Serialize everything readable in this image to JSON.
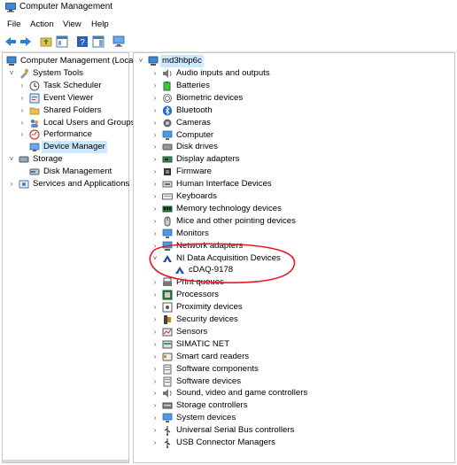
{
  "window": {
    "title": "Computer Management"
  },
  "menu": [
    "File",
    "Action",
    "View",
    "Help"
  ],
  "left_tree": [
    {
      "label": "Computer Management (Local)",
      "icon": "computer-management-icon",
      "level": 0,
      "expander": "",
      "selected": false
    },
    {
      "label": "System Tools",
      "icon": "tools-icon",
      "level": 1,
      "expander": "˅",
      "selected": false
    },
    {
      "label": "Task Scheduler",
      "icon": "clock-icon",
      "level": 2,
      "expander": "›",
      "selected": false
    },
    {
      "label": "Event Viewer",
      "icon": "event-viewer-icon",
      "level": 2,
      "expander": "›",
      "selected": false
    },
    {
      "label": "Shared Folders",
      "icon": "folder-icon",
      "level": 2,
      "expander": "›",
      "selected": false
    },
    {
      "label": "Local Users and Groups",
      "icon": "users-icon",
      "level": 2,
      "expander": "›",
      "selected": false
    },
    {
      "label": "Performance",
      "icon": "performance-icon",
      "level": 2,
      "expander": "›",
      "selected": false
    },
    {
      "label": "Device Manager",
      "icon": "device-manager-icon",
      "level": 2,
      "expander": "",
      "selected": true
    },
    {
      "label": "Storage",
      "icon": "storage-icon",
      "level": 1,
      "expander": "˅",
      "selected": false
    },
    {
      "label": "Disk Management",
      "icon": "disk-icon",
      "level": 2,
      "expander": "",
      "selected": false
    },
    {
      "label": "Services and Applications",
      "icon": "services-icon",
      "level": 1,
      "expander": "›",
      "selected": false
    }
  ],
  "device_tree": {
    "root": "md3hbp6c",
    "categories": [
      {
        "label": "Audio inputs and outputs",
        "icon": "speaker-icon"
      },
      {
        "label": "Batteries",
        "icon": "battery-icon"
      },
      {
        "label": "Biometric devices",
        "icon": "fingerprint-icon"
      },
      {
        "label": "Bluetooth",
        "icon": "bluetooth-icon"
      },
      {
        "label": "Cameras",
        "icon": "camera-icon"
      },
      {
        "label": "Computer",
        "icon": "monitor-icon"
      },
      {
        "label": "Disk drives",
        "icon": "disk-drive-icon"
      },
      {
        "label": "Display adapters",
        "icon": "display-adapter-icon"
      },
      {
        "label": "Firmware",
        "icon": "chip-icon"
      },
      {
        "label": "Human Interface Devices",
        "icon": "hid-icon"
      },
      {
        "label": "Keyboards",
        "icon": "keyboard-icon"
      },
      {
        "label": "Memory technology devices",
        "icon": "memory-icon"
      },
      {
        "label": "Mice and other pointing devices",
        "icon": "mouse-icon"
      },
      {
        "label": "Monitors",
        "icon": "monitor-icon"
      },
      {
        "label": "Network adapters",
        "icon": "network-icon"
      },
      {
        "label": "NI Data Acquisition Devices",
        "icon": "ni-daq-icon",
        "expanded": true,
        "children": [
          {
            "label": "cDAQ-9178",
            "icon": "ni-daq-icon"
          }
        ]
      },
      {
        "label": "Print queues",
        "icon": "printer-icon"
      },
      {
        "label": "Processors",
        "icon": "processor-icon"
      },
      {
        "label": "Proximity devices",
        "icon": "proximity-icon"
      },
      {
        "label": "Security devices",
        "icon": "security-icon"
      },
      {
        "label": "Sensors",
        "icon": "sensor-icon"
      },
      {
        "label": "SIMATIC NET",
        "icon": "simatic-icon"
      },
      {
        "label": "Smart card readers",
        "icon": "smartcard-icon"
      },
      {
        "label": "Software components",
        "icon": "software-icon"
      },
      {
        "label": "Software devices",
        "icon": "software-icon"
      },
      {
        "label": "Sound, video and game controllers",
        "icon": "speaker-icon"
      },
      {
        "label": "Storage controllers",
        "icon": "storage-controller-icon"
      },
      {
        "label": "System devices",
        "icon": "system-icon"
      },
      {
        "label": "Universal Serial Bus controllers",
        "icon": "usb-icon"
      },
      {
        "label": "USB Connector Managers",
        "icon": "usb-icon"
      }
    ]
  },
  "annotation": {
    "color": "#e8182a"
  },
  "colors": {
    "selection": "#cde8ff",
    "ni_blue": "#1b4fa0"
  }
}
